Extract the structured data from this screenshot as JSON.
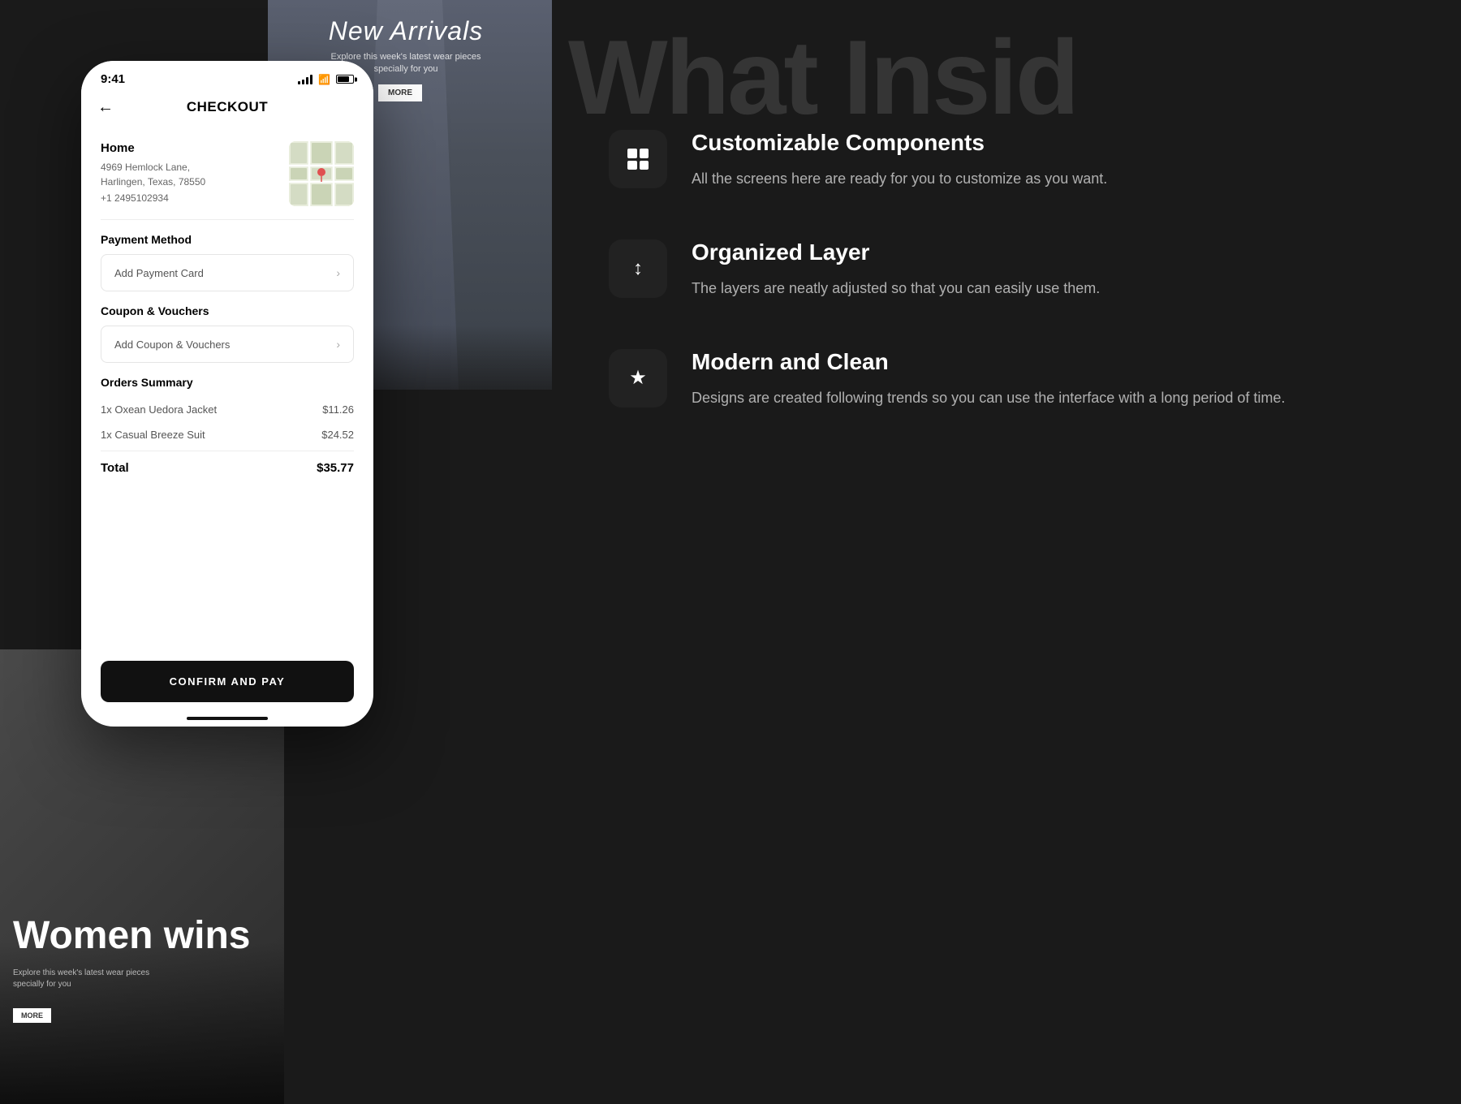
{
  "background": {
    "what_inside": "What Insid",
    "new_arrivals_title": "New Arrivals",
    "new_arrivals_subtitle": "Explore this week's latest wear pieces specially for you",
    "more_label": "MORE",
    "women_wins": "Women wins",
    "women_subtitle": "Explore this week's latest wear pieces specially for you",
    "more_label_2": "MORE"
  },
  "features": [
    {
      "icon": "⊞",
      "icon_name": "grid-icon",
      "title": "Customizable Components",
      "desc": "All the screens here are ready for you to customize as you want."
    },
    {
      "icon": "↕",
      "icon_name": "layers-icon",
      "title": "Organized Layer",
      "desc": "The layers are neatly adjusted so that you can easily use them."
    },
    {
      "icon": "★",
      "icon_name": "star-icon",
      "title": "Modern and Clean",
      "desc": "Designs are created following trends so you can use the interface with a long period of time."
    }
  ],
  "phone": {
    "status_bar": {
      "time": "9:41",
      "time_label": "9.41"
    },
    "header": {
      "back_label": "←",
      "title": "CHECKOUT"
    },
    "address": {
      "label": "Home",
      "line1": "4969 Hemlock Lane,",
      "line2": "Harlingen, Texas, 78550",
      "phone": "+1 2495102934"
    },
    "payment": {
      "section_label": "Payment Method",
      "add_label": "Add Payment Card"
    },
    "coupon": {
      "section_label": "Coupon & Vouchers",
      "add_label": "Add Coupon & Vouchers"
    },
    "orders": {
      "section_label": "Orders Summary",
      "items": [
        {
          "qty_name": "1x Oxean Uedora Jacket",
          "price": "$11.26"
        },
        {
          "qty_name": "1x Casual Breeze Suit",
          "price": "$24.52"
        }
      ],
      "total_label": "Total",
      "total_amount": "$35.77"
    },
    "cta": {
      "label": "CONFIRM AND PAY"
    }
  }
}
